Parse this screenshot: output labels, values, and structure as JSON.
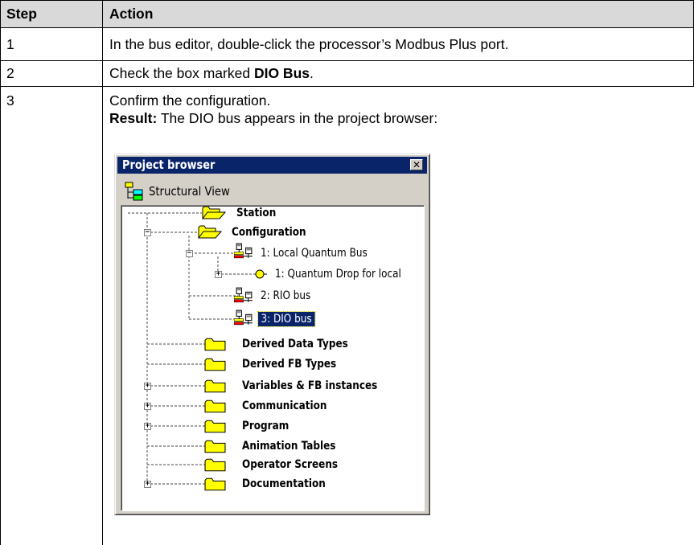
{
  "table": {
    "headers": {
      "step": "Step",
      "action": "Action"
    },
    "rows": [
      {
        "step": "1",
        "action": "In the bus editor, double-click the processor’s Modbus Plus port."
      },
      {
        "step": "2",
        "action_prefix": "Check the box marked ",
        "action_bold": "DIO Bus",
        "action_suffix": "."
      },
      {
        "step": "3",
        "action": "Confirm the configuration.",
        "result_label": "Result:",
        "result_text": " The DIO bus appears in the project browser:"
      }
    ]
  },
  "project_browser": {
    "title": "Project browser",
    "close_glyph": "✕",
    "view_label": "Structural View",
    "tree": {
      "station": "Station",
      "configuration": "Configuration",
      "local_bus": "1: Local Quantum Bus",
      "drop": "1: Quantum Drop for local",
      "rio_bus": "2: RIO bus",
      "dio_bus": "3: DIO bus",
      "derived_data_types": "Derived Data Types",
      "derived_fb_types": "Derived FB Types",
      "variables": "Variables & FB instances",
      "communication": "Communication",
      "program": "Program",
      "animation_tables": "Animation Tables",
      "operator_screens": "Operator Screens",
      "documentation": "Documentation"
    },
    "selected_item": "3: DIO bus",
    "colors": {
      "selection": "#0a246a",
      "folder": "#ffff00",
      "title_bar": "#0a246a"
    }
  }
}
